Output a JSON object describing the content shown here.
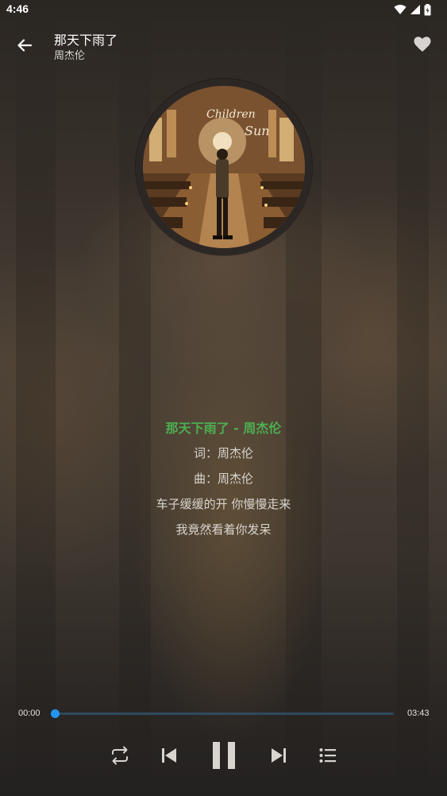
{
  "status_bar": {
    "time": "4:46",
    "icons": [
      "wifi-icon",
      "signal-icon",
      "battery-icon"
    ]
  },
  "header": {
    "title": "那天下雨了",
    "artist": "周杰伦",
    "back_icon": "arrow-left-icon",
    "favorite_icon": "heart-icon"
  },
  "album": {
    "cover_text_1": "Children",
    "cover_text_2": "Sun"
  },
  "lyrics": {
    "current_line": "那天下雨了 - 周杰伦",
    "lines": [
      "词：周杰伦",
      "曲：周杰伦",
      "车子缓缓的开 你慢慢走来",
      "我竟然看着你发呆"
    ]
  },
  "progress": {
    "elapsed": "00:00",
    "duration": "03:43",
    "fraction": 0.0
  },
  "controls": {
    "repeat_icon": "repeat-icon",
    "previous_icon": "skip-previous-icon",
    "pause_icon": "pause-icon",
    "next_icon": "skip-next-icon",
    "playlist_icon": "playlist-icon"
  },
  "colors": {
    "accent": "#2196f3",
    "lyric_active": "#4caf50",
    "lyric_text": "#d9d5d0"
  }
}
